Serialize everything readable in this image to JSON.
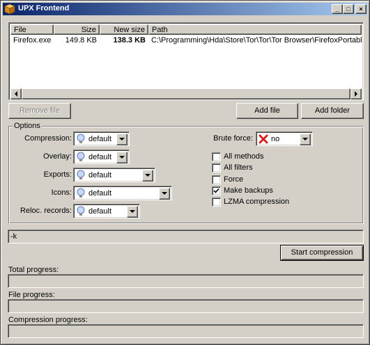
{
  "window": {
    "title": "UPX Frontend",
    "minimize_glyph": "_",
    "maximize_glyph": "□",
    "close_glyph": "×"
  },
  "file_list": {
    "columns": [
      "File",
      "Size",
      "New size",
      "Path"
    ],
    "rows": [
      {
        "file": "Firefox.exe",
        "size": "149.8 KB",
        "new_size": "138.3 KB",
        "path": "C:\\Programming\\Hda\\Store\\Tor\\Tor\\Tor Browser\\FirefoxPortable\\"
      }
    ]
  },
  "buttons": {
    "remove_file": "Remove file",
    "add_file": "Add file",
    "add_folder": "Add folder",
    "start_compression": "Start compression"
  },
  "options": {
    "title": "Options",
    "compression": {
      "label": "Compression:",
      "value": "default"
    },
    "overlay": {
      "label": "Overlay:",
      "value": "default"
    },
    "exports": {
      "label": "Exports:",
      "value": "default"
    },
    "icons": {
      "label": "Icons:",
      "value": "default"
    },
    "reloc_records": {
      "label": "Reloc. records:",
      "value": "default"
    },
    "brute_force": {
      "label": "Brute force:",
      "value": "no"
    },
    "checkboxes": [
      {
        "label": "All methods",
        "checked": false
      },
      {
        "label": "All filters",
        "checked": false
      },
      {
        "label": "Force",
        "checked": false
      },
      {
        "label": "Make backups",
        "checked": true
      },
      {
        "label": "LZMA compression",
        "checked": false
      }
    ]
  },
  "command_line": {
    "value": "-k"
  },
  "progress": {
    "total": {
      "label": "Total progress:",
      "value": 0
    },
    "file": {
      "label": "File progress:",
      "value": 0
    },
    "compression": {
      "label": "Compression progress:",
      "value": 0
    }
  },
  "colors": {
    "title_start": "#0a246a",
    "title_end": "#a6caf0",
    "face": "#d4d0c8"
  },
  "icons": {
    "app": "package-icon",
    "option_default": "lightbulb-icon",
    "brute_no": "red-x-icon",
    "dropdown": "chevron-down-icon"
  }
}
